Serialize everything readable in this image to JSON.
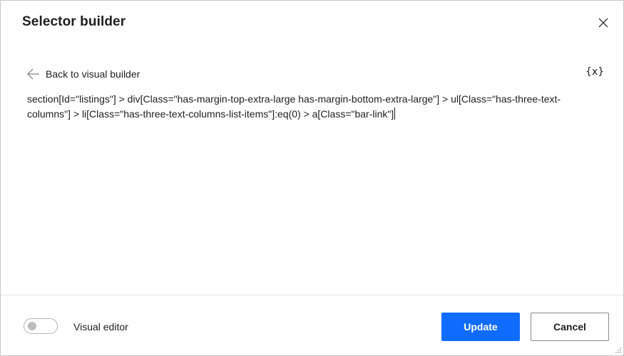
{
  "dialog": {
    "title": "Selector builder",
    "close_icon": "close-icon"
  },
  "toolbar": {
    "back_label": "Back to visual builder",
    "back_icon": "arrow-left-icon",
    "variables_label": "{x}"
  },
  "editor": {
    "selector_text": "section[Id=\"listings\"] > div[Class=\"has-margin-top-extra-large has-margin-bottom-extra-large\"] > ul[Class=\"has-three-text-columns\"] > li[Class=\"has-three-text-columns-list-items\"]:eq(0) > a[Class=\"bar-link\"]"
  },
  "footer": {
    "toggle_label": "Visual editor",
    "toggle_on": false,
    "update_label": "Update",
    "cancel_label": "Cancel"
  },
  "colors": {
    "primary": "#0f6cff",
    "border": "#c8c8c8",
    "text": "#1f1f1f"
  }
}
